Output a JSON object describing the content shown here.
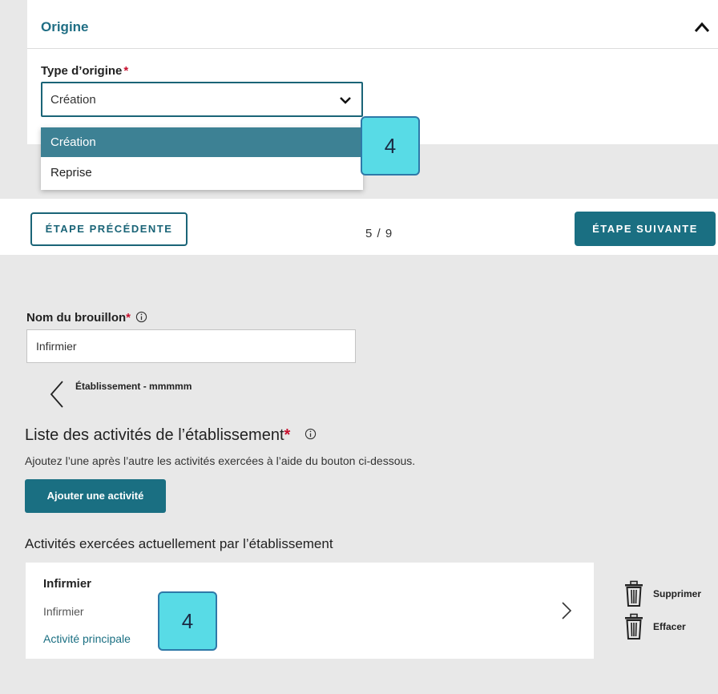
{
  "origin_section": {
    "title": "Origine",
    "type_label": "Type d’origine",
    "required_mark": "*",
    "selected_value": "Création",
    "options": [
      "Création",
      "Reprise"
    ]
  },
  "callouts": {
    "first": "4",
    "second": "4"
  },
  "navigation": {
    "previous_label": "ÉTAPE PRÉCÉDENTE",
    "step_indicator": "5 / 9",
    "next_label": "ÉTAPE SUIVANTE"
  },
  "draft": {
    "label": "Nom du brouillon",
    "required_mark": "*",
    "value": "Infirmier"
  },
  "establishment": {
    "title": "Établissement - mmmmm"
  },
  "activities": {
    "list_title": "Liste des activités de l’établissement",
    "required_mark": "*",
    "description": "Ajoutez l’une après l’autre les activités exercées à l’aide du bouton ci-dessous.",
    "add_button": "Ajouter une activité",
    "current_title": "Activités exercées actuellement par l’établissement",
    "items": [
      {
        "name": "Infirmier",
        "subtitle": "Infirmier",
        "tag": "Activité principale"
      }
    ],
    "actions": {
      "delete": "Supprimer",
      "clear": "Effacer"
    }
  },
  "icons": {
    "collapse": "chevron-up-icon",
    "select_caret": "chevron-down-icon",
    "info": "info-icon",
    "back": "chevron-left-icon",
    "open_activity": "chevron-right-icon",
    "trash": "trash-icon"
  },
  "colors": {
    "accent": "#1a6f82",
    "selected_option": "#3d8194",
    "required": "#c8102e",
    "callout_fill": "#58dbe6",
    "background": "#e8e8e8"
  }
}
